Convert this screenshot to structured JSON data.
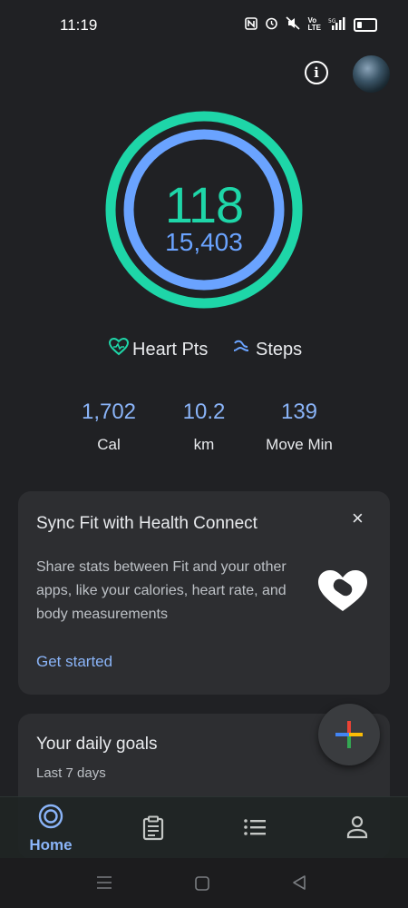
{
  "status_bar": {
    "time": "11:19"
  },
  "rings": {
    "heart_points": "118",
    "steps": "15,403"
  },
  "legend": {
    "heart_pts": "Heart Pts",
    "steps": "Steps"
  },
  "stats": [
    {
      "value": "1,702",
      "label": "Cal"
    },
    {
      "value": "10.2",
      "label": "km"
    },
    {
      "value": "139",
      "label": "Move Min"
    }
  ],
  "health_connect_card": {
    "title": "Sync Fit with Health Connect",
    "body": "Share stats between Fit and your other apps, like your calories, heart rate, and body measurements",
    "action": "Get started",
    "close_icon": "×"
  },
  "goals_card": {
    "title": "Your daily goals",
    "subtitle": "Last 7 days"
  },
  "bottom_nav": {
    "home_label": "Home"
  },
  "colors": {
    "heart_ring": "#1ed6a8",
    "steps_ring": "#6aa3ff",
    "link": "#8ab4f8"
  }
}
